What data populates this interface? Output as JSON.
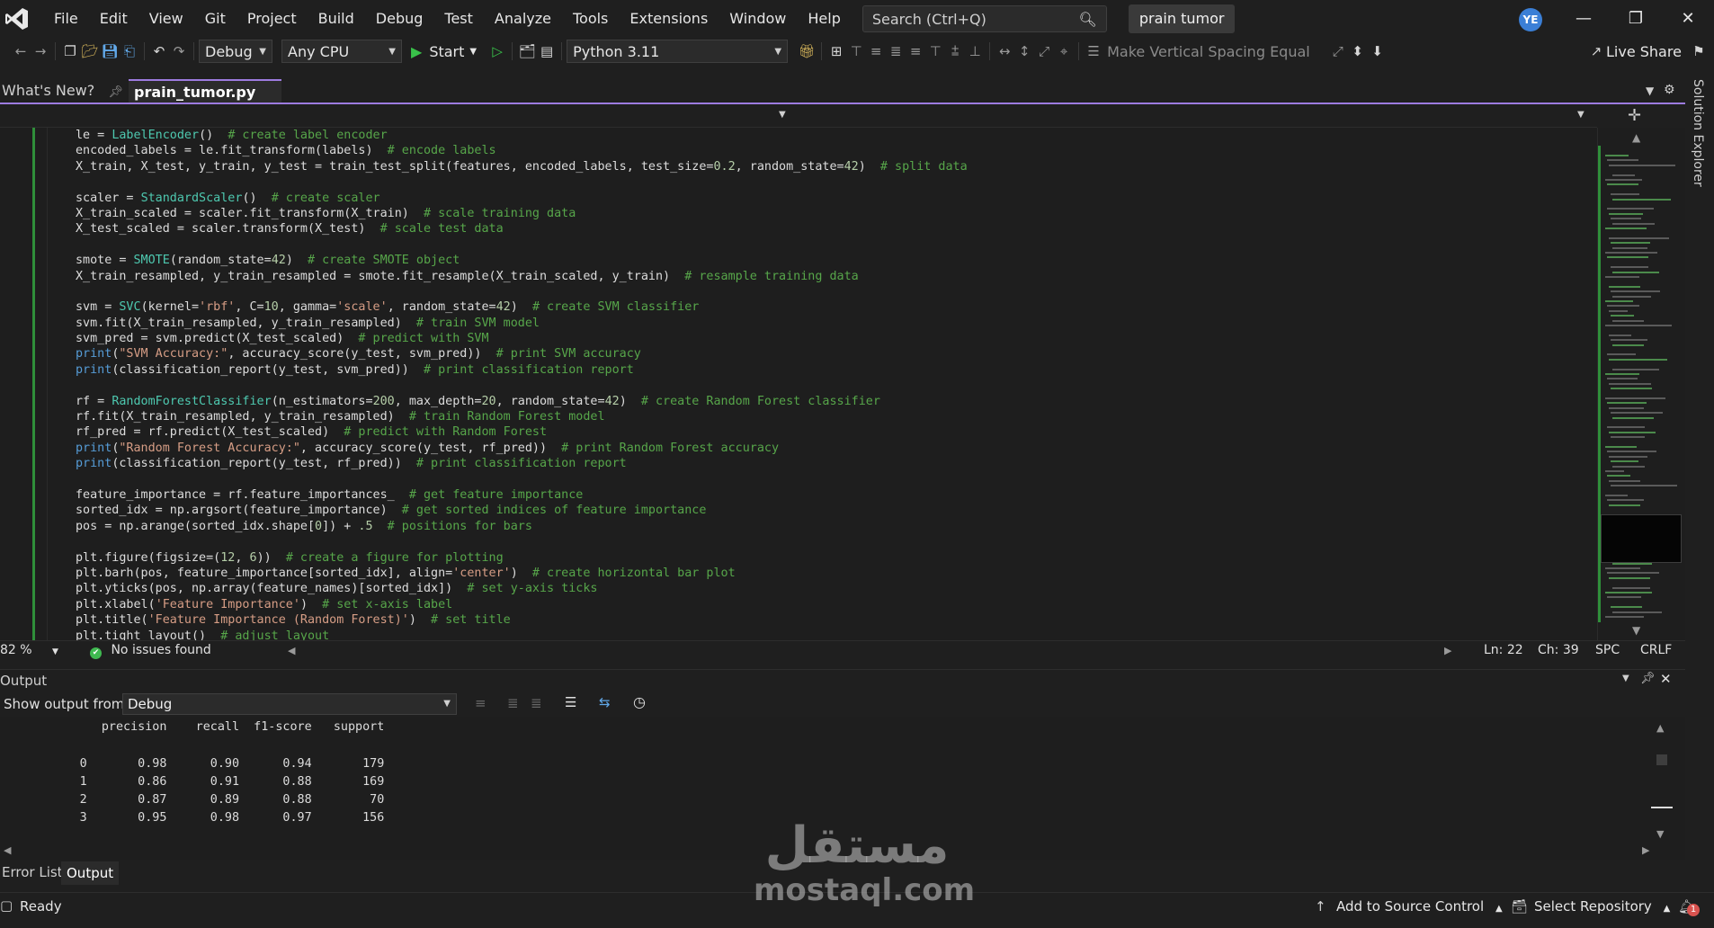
{
  "menu": [
    "File",
    "Edit",
    "View",
    "Git",
    "Project",
    "Build",
    "Debug",
    "Test",
    "Analyze",
    "Tools",
    "Extensions",
    "Window",
    "Help"
  ],
  "search": {
    "placeholder": "Search (Ctrl+Q)"
  },
  "solution_name": "prain tumor",
  "account_initials": "YE",
  "toolbar": {
    "configuration": "Debug",
    "platform": "Any CPU",
    "start_label": "Start",
    "python_env": "Python 3.11",
    "make_vertical_spacing_equal": "Make Vertical Spacing Equal",
    "live_share": "Live Share"
  },
  "tabs": {
    "whats_new": "What's New?",
    "active": "prain_tumor.py"
  },
  "code_lines": [
    [
      [
        "",
        "le = "
      ],
      [
        "fn",
        "LabelEncoder"
      ],
      [
        "",
        "()  "
      ],
      [
        "com",
        "# create label encoder"
      ]
    ],
    [
      [
        "",
        "encoded_labels = le.fit_transform(labels)  "
      ],
      [
        "com",
        "# encode labels"
      ]
    ],
    [
      [
        "",
        "X_train, X_test, y_train, y_test = train_test_split(features, encoded_labels, test_size="
      ],
      [
        "num",
        "0.2"
      ],
      [
        "",
        ", random_state="
      ],
      [
        "num",
        "42"
      ],
      [
        "",
        ")  "
      ],
      [
        "com",
        "# split data"
      ]
    ],
    [
      [
        "",
        ""
      ]
    ],
    [
      [
        "",
        "scaler = "
      ],
      [
        "fn",
        "StandardScaler"
      ],
      [
        "",
        "()  "
      ],
      [
        "com",
        "# create scaler"
      ]
    ],
    [
      [
        "",
        "X_train_scaled = scaler.fit_transform(X_train)  "
      ],
      [
        "com",
        "# scale training data"
      ]
    ],
    [
      [
        "",
        "X_test_scaled = scaler.transform(X_test)  "
      ],
      [
        "com",
        "# scale test data"
      ]
    ],
    [
      [
        "",
        ""
      ]
    ],
    [
      [
        "",
        "smote = "
      ],
      [
        "fn",
        "SMOTE"
      ],
      [
        "",
        "(random_state="
      ],
      [
        "num",
        "42"
      ],
      [
        "",
        ")  "
      ],
      [
        "com",
        "# create SMOTE object"
      ]
    ],
    [
      [
        "",
        "X_train_resampled, y_train_resampled = smote.fit_resample(X_train_scaled, y_train)  "
      ],
      [
        "com",
        "# resample training data"
      ]
    ],
    [
      [
        "",
        ""
      ]
    ],
    [
      [
        "",
        "svm = "
      ],
      [
        "fn",
        "SVC"
      ],
      [
        "",
        "(kernel="
      ],
      [
        "str",
        "'rbf'"
      ],
      [
        "",
        ", C="
      ],
      [
        "num",
        "10"
      ],
      [
        "",
        ", gamma="
      ],
      [
        "str",
        "'scale'"
      ],
      [
        "",
        ", random_state="
      ],
      [
        "num",
        "42"
      ],
      [
        "",
        ")  "
      ],
      [
        "com",
        "# create SVM classifier"
      ]
    ],
    [
      [
        "",
        "svm.fit(X_train_resampled, y_train_resampled)  "
      ],
      [
        "com",
        "# train SVM model"
      ]
    ],
    [
      [
        "",
        "svm_pred = svm.predict(X_test_scaled)  "
      ],
      [
        "com",
        "# predict with SVM"
      ]
    ],
    [
      [
        "kw",
        "print"
      ],
      [
        "",
        "("
      ],
      [
        "str",
        "\"SVM Accuracy:\""
      ],
      [
        "",
        ", accuracy_score(y_test, svm_pred))  "
      ],
      [
        "com",
        "# print SVM accuracy"
      ]
    ],
    [
      [
        "kw",
        "print"
      ],
      [
        "",
        "(classification_report(y_test, svm_pred))  "
      ],
      [
        "com",
        "# print classification report"
      ]
    ],
    [
      [
        "",
        ""
      ]
    ],
    [
      [
        "",
        "rf = "
      ],
      [
        "fn",
        "RandomForestClassifier"
      ],
      [
        "",
        "(n_estimators="
      ],
      [
        "num",
        "200"
      ],
      [
        "",
        ", max_depth="
      ],
      [
        "num",
        "20"
      ],
      [
        "",
        ", random_state="
      ],
      [
        "num",
        "42"
      ],
      [
        "",
        ")  "
      ],
      [
        "com",
        "# create Random Forest classifier"
      ]
    ],
    [
      [
        "",
        "rf.fit(X_train_resampled, y_train_resampled)  "
      ],
      [
        "com",
        "# train Random Forest model"
      ]
    ],
    [
      [
        "",
        "rf_pred = rf.predict(X_test_scaled)  "
      ],
      [
        "com",
        "# predict with Random Forest"
      ]
    ],
    [
      [
        "kw",
        "print"
      ],
      [
        "",
        "("
      ],
      [
        "str",
        "\"Random Forest Accuracy:\""
      ],
      [
        "",
        ", accuracy_score(y_test, rf_pred))  "
      ],
      [
        "com",
        "# print Random Forest accuracy"
      ]
    ],
    [
      [
        "kw",
        "print"
      ],
      [
        "",
        "(classification_report(y_test, rf_pred))  "
      ],
      [
        "com",
        "# print classification report"
      ]
    ],
    [
      [
        "",
        ""
      ]
    ],
    [
      [
        "",
        "feature_importance = rf.feature_importances_  "
      ],
      [
        "com",
        "# get feature importance"
      ]
    ],
    [
      [
        "",
        "sorted_idx = np.argsort(feature_importance)  "
      ],
      [
        "com",
        "# get sorted indices of feature importance"
      ]
    ],
    [
      [
        "",
        "pos = np.arange(sorted_idx.shape["
      ],
      [
        "num",
        "0"
      ],
      [
        "",
        "]) + "
      ],
      [
        "num",
        ".5"
      ],
      [
        "",
        "  "
      ],
      [
        "com",
        "# positions for bars"
      ]
    ],
    [
      [
        "",
        ""
      ]
    ],
    [
      [
        "",
        "plt.figure(figsize=("
      ],
      [
        "num",
        "12"
      ],
      [
        "",
        ", "
      ],
      [
        "num",
        "6"
      ],
      [
        "",
        "))  "
      ],
      [
        "com",
        "# create a figure for plotting"
      ]
    ],
    [
      [
        "",
        "plt.barh(pos, feature_importance[sorted_idx], align="
      ],
      [
        "str",
        "'center'"
      ],
      [
        "",
        ")  "
      ],
      [
        "com",
        "# create horizontal bar plot"
      ]
    ],
    [
      [
        "",
        "plt.yticks(pos, np.array(feature_names)[sorted_idx])  "
      ],
      [
        "com",
        "# set y-axis ticks"
      ]
    ],
    [
      [
        "",
        "plt.xlabel("
      ],
      [
        "str",
        "'Feature Importance'"
      ],
      [
        "",
        ")  "
      ],
      [
        "com",
        "# set x-axis label"
      ]
    ],
    [
      [
        "",
        "plt.title("
      ],
      [
        "str",
        "'Feature Importance (Random Forest)'"
      ],
      [
        "",
        ")  "
      ],
      [
        "com",
        "# set title"
      ]
    ],
    [
      [
        "",
        "plt.tight_layout()  "
      ],
      [
        "com",
        "# adjust layout"
      ]
    ]
  ],
  "editor_status": {
    "zoom": "82 %",
    "issues": "No issues found",
    "line": "Ln: 22",
    "col": "Ch: 39",
    "whitespace": "SPC",
    "line_endings": "CRLF"
  },
  "output": {
    "title": "Output",
    "show_from_label": "Show output from:",
    "source": "Debug",
    "lines": [
      "              precision    recall  f1-score   support",
      "",
      "           0       0.98      0.90      0.94       179",
      "           1       0.86      0.91      0.88       169",
      "           2       0.87      0.89      0.88        70",
      "           3       0.95      0.98      0.97       156"
    ]
  },
  "bottom_tabs": {
    "error_list": "Error List",
    "output": "Output"
  },
  "statusbar": {
    "ready": "Ready",
    "source_control": "Add to Source Control",
    "repository": "Select Repository",
    "notifications": "1"
  },
  "side_panel": {
    "solution_explorer": "Solution Explorer"
  },
  "watermark": {
    "arabic": "مستقل",
    "latin": "mostaql.com"
  },
  "colors": {
    "accent": "#9d7be0",
    "change_bar": "#2f8f3a",
    "ok": "#3fb950",
    "avatar": "#3b7fd6"
  }
}
